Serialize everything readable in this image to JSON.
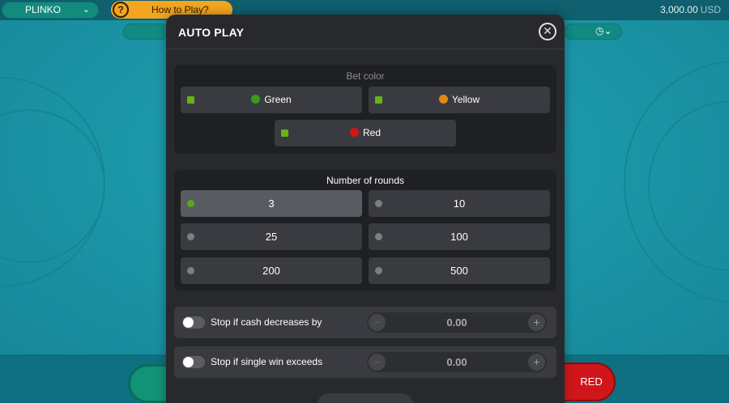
{
  "header": {
    "game_name": "PLINKO",
    "help_label": "How to Play?",
    "balance_amount": "3,000.00",
    "balance_currency": "USD"
  },
  "game": {
    "red_button_label": "RED"
  },
  "modal": {
    "title": "AUTO PLAY",
    "bet_color": {
      "title": "Bet color",
      "options": [
        {
          "label": "Green",
          "color": "#3a9a1a",
          "checked": true
        },
        {
          "label": "Yellow",
          "color": "#e08a12",
          "checked": true
        },
        {
          "label": "Red",
          "color": "#d41414",
          "checked": true
        }
      ]
    },
    "rounds": {
      "title": "Number of rounds",
      "options": [
        {
          "label": "3",
          "selected": true
        },
        {
          "label": "10",
          "selected": false
        },
        {
          "label": "25",
          "selected": false
        },
        {
          "label": "100",
          "selected": false
        },
        {
          "label": "200",
          "selected": false
        },
        {
          "label": "500",
          "selected": false
        }
      ]
    },
    "stop_conditions": [
      {
        "label": "Stop if cash decreases by",
        "value": "0.00",
        "enabled": false
      },
      {
        "label": "Stop if single win exceeds",
        "value": "0.00",
        "enabled": false
      }
    ],
    "stepper_minus": "−",
    "stepper_plus": "+"
  }
}
